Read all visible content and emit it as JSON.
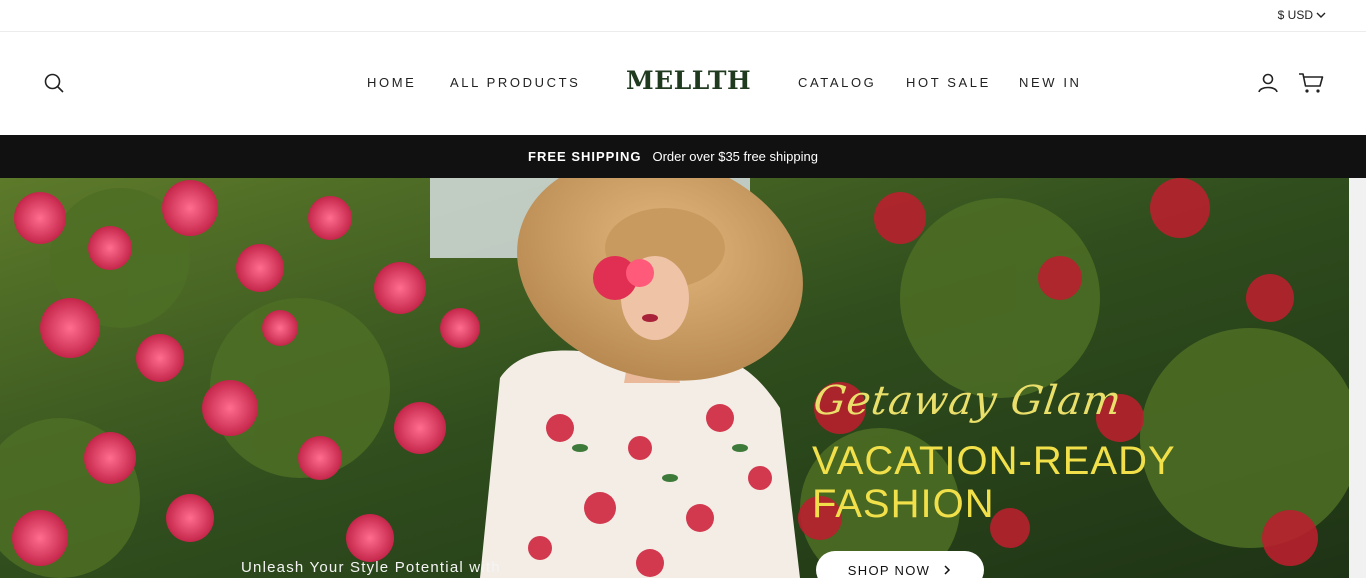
{
  "topbar": {
    "currency": "$ USD"
  },
  "header": {
    "logo": "MELLTH",
    "nav_left": [
      "HOME",
      "ALL PRODUCTS"
    ],
    "nav_right": [
      "CATALOG",
      "HOT SALE",
      "NEW IN"
    ],
    "icons": {
      "search": "search-icon",
      "account": "user-icon",
      "cart": "cart-icon"
    }
  },
  "announcement": {
    "title": "FREE SHIPPING",
    "text": "Order over $35 free shipping"
  },
  "hero": {
    "script_text": "Getaway Glam",
    "headline_line1": "VACATION-READY",
    "headline_line2": "FASHION",
    "cta": "SHOP NOW",
    "tagline": "Unleash Your Style Potential with"
  },
  "colors": {
    "announce_bg": "#111111",
    "logo": "#1f3a1f",
    "headline": "#f2e04a"
  }
}
